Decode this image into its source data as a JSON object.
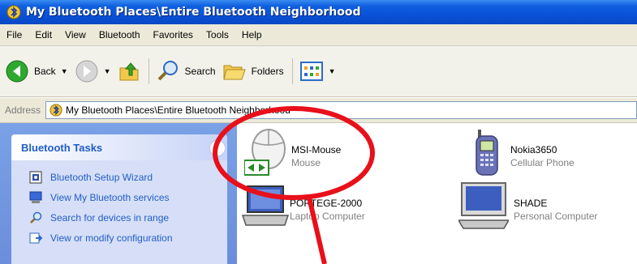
{
  "window": {
    "title": "My Bluetooth Places\\Entire Bluetooth Neighborhood"
  },
  "menu": [
    "File",
    "Edit",
    "View",
    "Bluetooth",
    "Favorites",
    "Tools",
    "Help"
  ],
  "toolbar": {
    "back_label": "Back",
    "search_label": "Search",
    "folders_label": "Folders"
  },
  "address": {
    "label": "Address",
    "value": "My Bluetooth Places\\Entire Bluetooth Neighborhood"
  },
  "tasks": {
    "title": "Bluetooth Tasks",
    "items": [
      {
        "label": "Bluetooth Setup Wizard",
        "icon": "wizard-icon"
      },
      {
        "label": "View My Bluetooth services",
        "icon": "computer-icon"
      },
      {
        "label": "Search for devices in range",
        "icon": "magnifier-icon"
      },
      {
        "label": "View or modify configuration",
        "icon": "config-icon"
      }
    ]
  },
  "devices": [
    {
      "name": "MSI-Mouse",
      "type": "Mouse",
      "icon": "mouse-icon"
    },
    {
      "name": "Nokia3650",
      "type": "Cellular Phone",
      "icon": "phone-icon"
    },
    {
      "name": "PORTEGE-2000",
      "type": "Laptop Computer",
      "icon": "laptop-icon"
    },
    {
      "name": "SHADE",
      "type": "Personal Computer",
      "icon": "desktop-icon"
    }
  ],
  "colors": {
    "titlebar": "#0a52d8",
    "task_link": "#215dc6",
    "annotation": "#e8101a"
  }
}
